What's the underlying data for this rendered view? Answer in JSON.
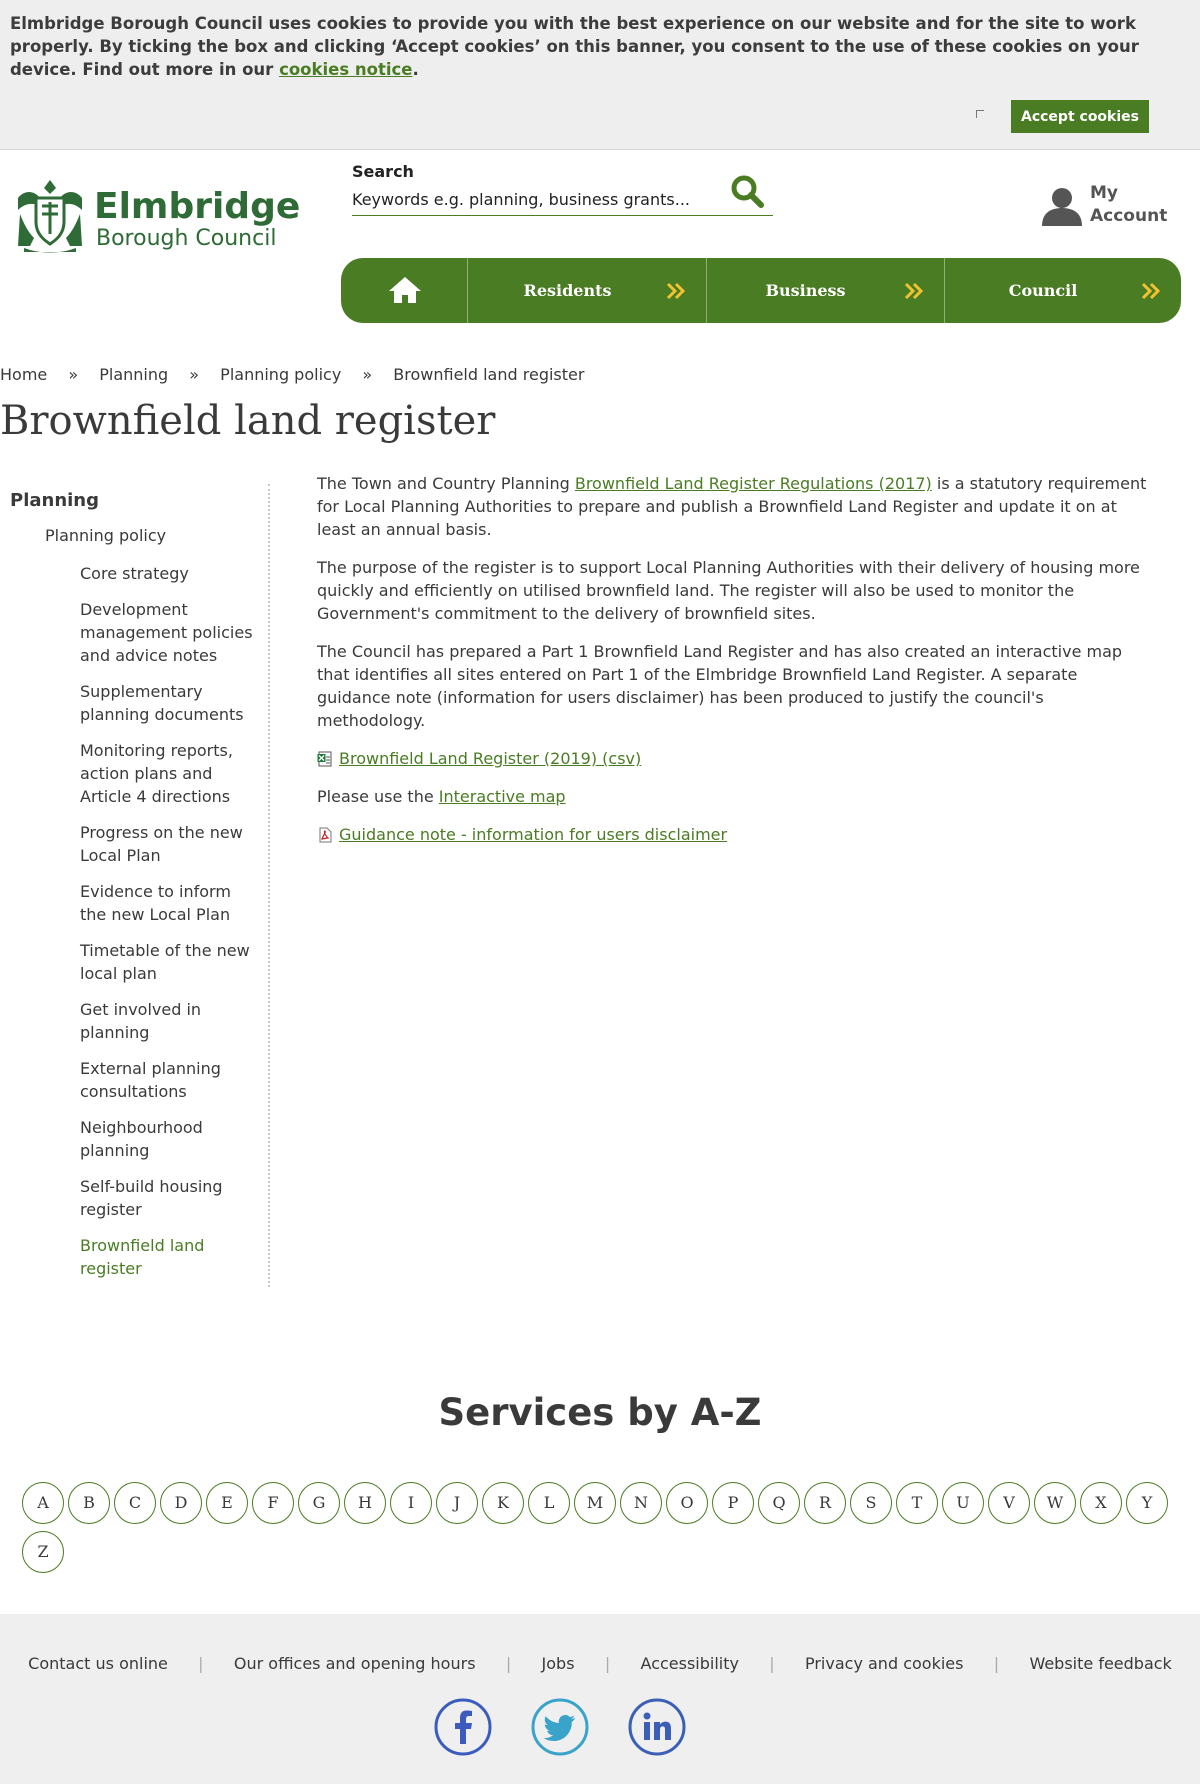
{
  "cookie_banner": {
    "text_before": "Elmbridge Borough Council uses cookies to provide you with the best experience on our website and for the site to work properly. By ticking the box and clicking ‘Accept cookies’ on this banner, you consent to the use of these cookies on your device. Find out more in our ",
    "link_text": "cookies notice",
    "text_after": ".",
    "accept_label": "Accept cookies"
  },
  "header": {
    "logo_name": "Elmbridge",
    "logo_sub": "Borough Council",
    "search_label": "Search",
    "search_placeholder": "Keywords e.g. planning, business grants...",
    "account_label": "My Account"
  },
  "nav": {
    "items": [
      {
        "label": "Residents"
      },
      {
        "label": "Business"
      },
      {
        "label": "Council"
      }
    ]
  },
  "breadcrumb": {
    "items": [
      "Home",
      "Planning",
      "Planning policy",
      "Brownfield land register"
    ],
    "separator": "»"
  },
  "page_title": "Brownfield land register",
  "sidebar": {
    "heading": "Planning",
    "sub": "Planning policy",
    "items": [
      "Core strategy",
      "Development management policies and advice notes",
      "Supplementary planning documents",
      "Monitoring reports, action plans and Article 4 directions",
      "Progress on the new Local Plan",
      "Evidence to inform the new Local Plan",
      "Timetable of the new local plan",
      "Get involved in planning",
      "External planning consultations",
      "Neighbourhood planning",
      "Self-build housing register",
      "Brownfield land register"
    ]
  },
  "content": {
    "p1_before": "The Town and Country Planning ",
    "p1_link": "Brownfield Land Register Regulations (2017)",
    "p1_after": " is a statutory requirement for Local Planning Authorities to prepare and publish a Brownfield Land Register and update it on at least an annual basis.",
    "p2": "The purpose of the register is to support Local Planning Authorities with their delivery of housing more quickly and efficiently on utilised brownfield land. The register will also be used to monitor the Government's commitment to the delivery of brownfield sites.",
    "p3": "The Council has prepared a Part 1 Brownfield Land Register and has also created an interactive map that identifies all sites entered on Part 1 of the Elmbridge Brownfield Land Register. A separate guidance note (information for users disclaimer) has been produced to justify the council's methodology.",
    "csv_link": "Brownfield Land Register (2019) (csv)",
    "map_before": "Please use the ",
    "map_link": "Interactive map",
    "pdf_link": "Guidance note - information for users disclaimer"
  },
  "az": {
    "title": "Services by A-Z",
    "letters": [
      "A",
      "B",
      "C",
      "D",
      "E",
      "F",
      "G",
      "H",
      "I",
      "J",
      "K",
      "L",
      "M",
      "N",
      "O",
      "P",
      "Q",
      "R",
      "S",
      "T",
      "U",
      "V",
      "W",
      "X",
      "Y",
      "Z"
    ]
  },
  "footer": {
    "links": [
      "Contact us online",
      "Our offices and opening hours",
      "Jobs",
      "Accessibility",
      "Privacy and cookies",
      "Website feedback"
    ],
    "separator": "|",
    "social": [
      "facebook-icon",
      "twitter-icon",
      "linkedin-icon"
    ]
  },
  "colors": {
    "brand_green": "#4a7c23",
    "logo_green": "#2e6b36",
    "arrow_yellow": "#f2c230",
    "facebook": "#3b5bbf",
    "twitter": "#3aa3c9",
    "linkedin": "#3a5fb5"
  }
}
